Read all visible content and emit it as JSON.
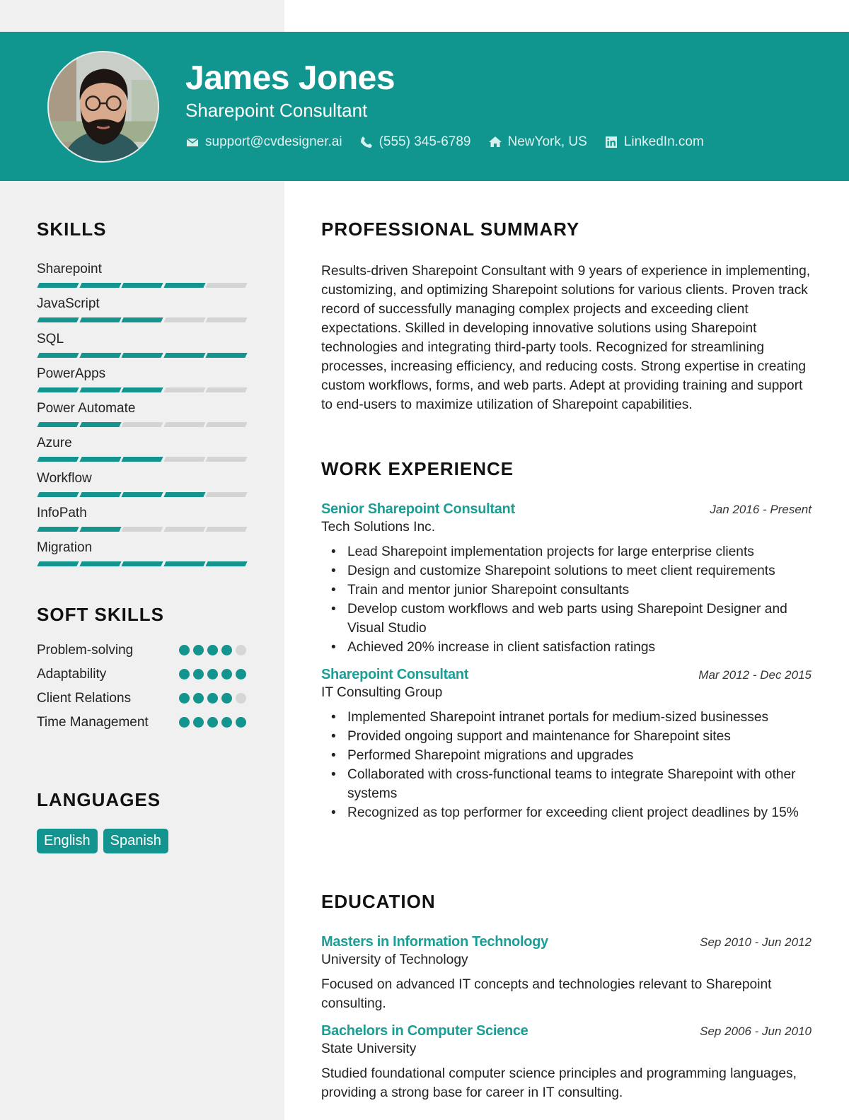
{
  "header": {
    "name": "James Jones",
    "title": "Sharepoint Consultant",
    "contacts": [
      {
        "icon": "envelope-icon",
        "text": "support@cvdesigner.ai"
      },
      {
        "icon": "phone-icon",
        "text": "(555) 345-6789"
      },
      {
        "icon": "home-icon",
        "text": "NewYork, US"
      },
      {
        "icon": "linkedin-icon",
        "text": "LinkedIn.com"
      }
    ]
  },
  "colors": {
    "accent": "#10958f",
    "sidebar_bg": "#f0f0f0",
    "inactive": "#d4d4d4"
  },
  "sidebar": {
    "skills_heading": "SKILLS",
    "skills": [
      {
        "name": "Sharepoint",
        "level": 4,
        "max": 5
      },
      {
        "name": "JavaScript",
        "level": 3,
        "max": 5
      },
      {
        "name": "SQL",
        "level": 5,
        "max": 5
      },
      {
        "name": "PowerApps",
        "level": 3,
        "max": 5
      },
      {
        "name": "Power Automate",
        "level": 2,
        "max": 5
      },
      {
        "name": "Azure",
        "level": 3,
        "max": 5
      },
      {
        "name": "Workflow",
        "level": 4,
        "max": 5
      },
      {
        "name": "InfoPath",
        "level": 2,
        "max": 5
      },
      {
        "name": "Migration",
        "level": 5,
        "max": 5
      }
    ],
    "soft_skills_heading": "SOFT SKILLS",
    "soft_skills": [
      {
        "name": "Problem-solving",
        "level": 4,
        "max": 5
      },
      {
        "name": "Adaptability",
        "level": 5,
        "max": 5
      },
      {
        "name": "Client Relations",
        "level": 4,
        "max": 5
      },
      {
        "name": "Time Management",
        "level": 5,
        "max": 5
      }
    ],
    "languages_heading": "LANGUAGES",
    "languages": [
      "English",
      "Spanish"
    ]
  },
  "main": {
    "summary_heading": "PROFESSIONAL SUMMARY",
    "summary": "Results-driven Sharepoint Consultant with 9 years of experience in implementing, customizing, and optimizing Sharepoint solutions for various clients. Proven track record of successfully managing complex projects and exceeding client expectations. Skilled in developing innovative solutions using Sharepoint technologies and integrating third-party tools. Recognized for streamlining processes, increasing efficiency, and reducing costs. Strong expertise in creating custom workflows, forms, and web parts. Adept at providing training and support to end-users to maximize utilization of Sharepoint capabilities.",
    "experience_heading": "WORK EXPERIENCE",
    "experience": [
      {
        "title": "Senior Sharepoint Consultant",
        "dates": "Jan 2016 - Present",
        "company": "Tech Solutions Inc.",
        "bullets": [
          "Lead Sharepoint implementation projects for large enterprise clients",
          "Design and customize Sharepoint solutions to meet client requirements",
          "Train and mentor junior Sharepoint consultants",
          "Develop custom workflows and web parts using Sharepoint Designer and Visual Studio",
          "Achieved 20% increase in client satisfaction ratings"
        ]
      },
      {
        "title": "Sharepoint Consultant",
        "dates": "Mar 2012 - Dec 2015",
        "company": "IT Consulting Group",
        "bullets": [
          "Implemented Sharepoint intranet portals for medium-sized businesses",
          "Provided ongoing support and maintenance for Sharepoint sites",
          "Performed Sharepoint migrations and upgrades",
          "Collaborated with cross-functional teams to integrate Sharepoint with other systems",
          "Recognized as top performer for exceeding client project deadlines by 15%"
        ]
      }
    ],
    "education_heading": "EDUCATION",
    "education": [
      {
        "degree": "Masters in Information Technology",
        "dates": "Sep 2010 - Jun 2012",
        "school": "University of Technology",
        "description": "Focused on advanced IT concepts and technologies relevant to Sharepoint consulting."
      },
      {
        "degree": "Bachelors in Computer Science",
        "dates": "Sep 2006 - Jun 2010",
        "school": "State University",
        "description": "Studied foundational computer science principles and programming languages, providing a strong base for career in IT consulting."
      }
    ]
  }
}
